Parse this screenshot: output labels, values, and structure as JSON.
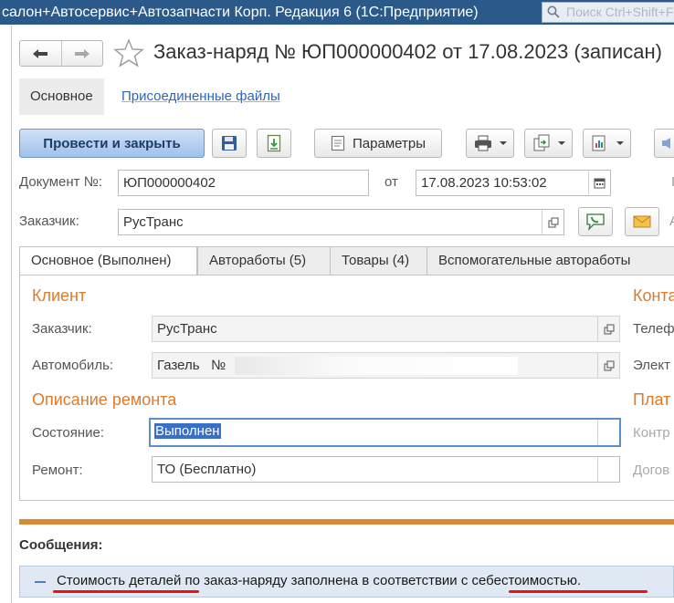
{
  "window": {
    "title": "салон+Автосервис+Автозапчасти Корп. Редакция 6  (1С:Предприятие)",
    "search_placeholder": "Поиск Ctrl+Shift+F"
  },
  "document": {
    "title": "Заказ-наряд № ЮП000000402 от 17.08.2023 (записан)"
  },
  "section_tabs": [
    {
      "label": "Основное",
      "active": true
    },
    {
      "label": "Присоединенные файлы",
      "active": false
    }
  ],
  "toolbar": {
    "post_close_label": "Провести и закрыть",
    "save_icon": "floppy-disk-icon",
    "post_icon": "post-document-icon",
    "params_label": "Параметры",
    "print_icon": "printer-icon",
    "create_based_icon": "create-based-on-icon",
    "reports_icon": "reports-icon"
  },
  "header_fields": {
    "doc_number_label": "Документ №:",
    "doc_number_value": "ЮП000000402",
    "date_label": "от",
    "date_value": "17.08.2023 10:53:02",
    "customer_label": "Заказчик:",
    "customer_value": "РусТранс"
  },
  "content_tabs": [
    {
      "label": "Основное (Выполнен)",
      "active": true
    },
    {
      "label": "Автоработы (5)",
      "active": false
    },
    {
      "label": "Товары (4)",
      "active": false
    },
    {
      "label": "Вспомогательные автоработы",
      "active": false
    }
  ],
  "client_group": {
    "title": "Клиент",
    "customer_label": "Заказчик:",
    "customer_value": "РусТранс",
    "car_label": "Автомобиль:",
    "car_value": "Газель   №"
  },
  "repair_group": {
    "title": "Описание ремонта",
    "state_label": "Состояние:",
    "state_value": "Выполнен",
    "repair_label": "Ремонт:",
    "repair_value": "ТО (Бесплатно)"
  },
  "right_column": {
    "contacts_title": "Конта",
    "phone_label": "Телеф",
    "email_label": "Элект",
    "payment_title": "Плат",
    "counterparty_label": "Контр",
    "contract_label": "Догов"
  },
  "messages": {
    "title": "Сообщения:",
    "items": [
      "Стоимость деталей по заказ-наряду заполнена в соответствии с себестоимостью."
    ]
  },
  "colors": {
    "titlebar": "#2b5a8a",
    "accent_orange": "#e07a2b",
    "primary_button": "#9fc1ea",
    "message_bg": "#dfe8f3",
    "underline_red": "#ee1111"
  }
}
